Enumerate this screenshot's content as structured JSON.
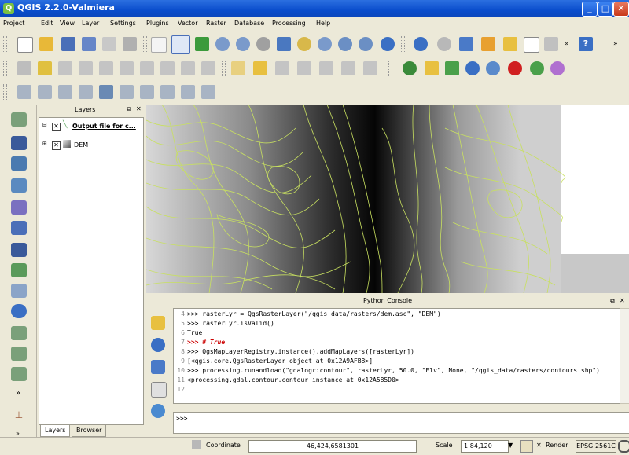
{
  "window": {
    "title": "QGIS 2.2.0-Valmiera"
  },
  "menubar": {
    "items": [
      "Project",
      "Edit",
      "View",
      "Layer",
      "Settings",
      "Plugins",
      "Vector",
      "Raster",
      "Database",
      "Processing",
      "Help"
    ]
  },
  "layers_panel": {
    "title": "Layers",
    "items": [
      {
        "label": "Output file for c..."
      },
      {
        "label": "DEM"
      }
    ],
    "tabs": [
      "Layers",
      "Browser"
    ]
  },
  "python_console": {
    "title": "Python Console",
    "lines": [
      {
        "n": "4",
        "text": ">>> rasterLyr = QgsRasterLayer(\"/qgis_data/rasters/dem.asc\", \"DEM\")"
      },
      {
        "n": "5",
        "text": ">>> rasterLyr.isValid()"
      },
      {
        "n": "6",
        "text": "True"
      },
      {
        "n": "7",
        "text": ">>> # True"
      },
      {
        "n": "8",
        "text": ">>> QgsMapLayerRegistry.instance().addMapLayers([rasterLyr])"
      },
      {
        "n": "9",
        "text": "[<qgis.core.QgsRasterLayer object at 0x12A9AFB8>]"
      },
      {
        "n": "10",
        "text": ">>> processing.runandload(\"gdalogr:contour\", rasterLyr, 50.0, \"Elv\", None, \"/qgis_data/rasters/contours.shp\")"
      },
      {
        "n": "11",
        "text": "<processing.gdal.contour.contour instance at 0x12A585D0>"
      },
      {
        "n": "12",
        "text": ""
      }
    ],
    "prompt": ">>>"
  },
  "statusbar": {
    "coord_label": "Coordinate",
    "coordinate": "46,424,6581301",
    "scale_label": "Scale",
    "scale": "1:84,120",
    "render_label": "Render",
    "crs": "EPSG:2561C"
  }
}
